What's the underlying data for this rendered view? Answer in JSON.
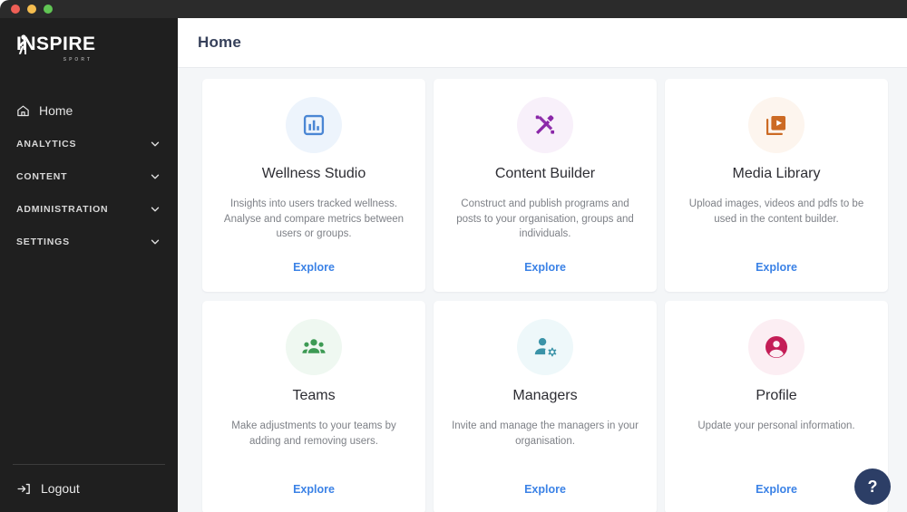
{
  "window": {
    "traffic_lights": [
      "close",
      "minimize",
      "maximize"
    ],
    "colors": {
      "close": "#ef5f56",
      "minimize": "#f5bd4f",
      "maximize": "#61c554"
    }
  },
  "sidebar": {
    "logo": {
      "name": "INSPIRE",
      "subtitle": "SPORT"
    },
    "home": {
      "label": "Home",
      "icon": "home-icon"
    },
    "groups": [
      {
        "label": "ANALYTICS",
        "icon": "chevron-down-icon"
      },
      {
        "label": "CONTENT",
        "icon": "chevron-down-icon"
      },
      {
        "label": "ADMINISTRATION",
        "icon": "chevron-down-icon"
      },
      {
        "label": "SETTINGS",
        "icon": "chevron-down-icon"
      }
    ],
    "logout": {
      "label": "Logout",
      "icon": "logout-icon"
    },
    "background": "#1f1f1f"
  },
  "header": {
    "title": "Home"
  },
  "main": {
    "background": "#f4f6f8",
    "cards": [
      {
        "title": "Wellness Studio",
        "description": "Insights into users tracked wellness. Analyse and compare metrics between users or groups.",
        "link": "Explore",
        "icon": "bar-chart-icon",
        "icon_color": "#4a86d4",
        "icon_bg": "#edf4fc"
      },
      {
        "title": "Content Builder",
        "description": "Construct and publish programs and posts to your organisation, groups and individuals.",
        "link": "Explore",
        "icon": "design-tools-icon",
        "icon_color": "#8a26a8",
        "icon_bg": "#f8f0fa"
      },
      {
        "title": "Media Library",
        "description": "Upload images, videos and pdfs to be used in the content builder.",
        "link": "Explore",
        "icon": "video-library-icon",
        "icon_color": "#cc6a24",
        "icon_bg": "#fdf5ee"
      },
      {
        "title": "Teams",
        "description": "Make adjustments to your teams by adding and removing users.",
        "link": "Explore",
        "icon": "groups-icon",
        "icon_color": "#3d9a54",
        "icon_bg": "#eff8f1"
      },
      {
        "title": "Managers",
        "description": "Invite and manage the managers in your organisation.",
        "link": "Explore",
        "icon": "manage-accounts-icon",
        "icon_color": "#3a93a8",
        "icon_bg": "#eef8fa"
      },
      {
        "title": "Profile",
        "description": "Update your personal information.",
        "link": "Explore",
        "icon": "account-circle-icon",
        "icon_color": "#c41e57",
        "icon_bg": "#fceef3"
      }
    ]
  },
  "help_button": {
    "label": "?",
    "color": "#2c3e66"
  }
}
